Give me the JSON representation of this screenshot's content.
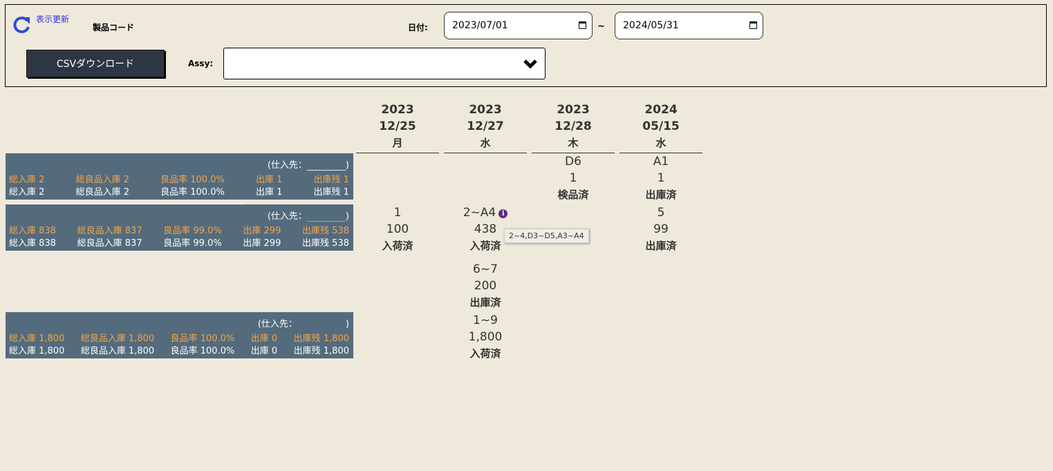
{
  "header": {
    "refresh_label": "表示更新",
    "product_code_label": "製品コード",
    "date_label": "日付:",
    "date_from": "2023/07/01",
    "date_to": "2024/05/31",
    "date_separator": "~",
    "csv_button_label": "CSVダウンロード",
    "assy_label": "Assy:",
    "assy_value": ""
  },
  "columns": [
    {
      "year": "2023",
      "date": "12/25",
      "dow": "月"
    },
    {
      "year": "2023",
      "date": "12/27",
      "dow": "水"
    },
    {
      "year": "2023",
      "date": "12/28",
      "dow": "木"
    },
    {
      "year": "2024",
      "date": "05/15",
      "dow": "水"
    }
  ],
  "panels": [
    {
      "supplier_prefix": "(仕入先：",
      "supplier_suffix": ")",
      "orange": [
        "総入庫 2",
        "総良品入庫 2",
        "良品率 100.0%",
        "出庫 1",
        "出庫残 1"
      ],
      "white": [
        "総入庫 2",
        "総良品入庫 2",
        "良品率 100.0%",
        "出庫 1",
        "出庫残 1"
      ]
    },
    {
      "supplier_prefix": "(仕入先：",
      "supplier_suffix": ")",
      "orange": [
        "総入庫 838",
        "総良品入庫 837",
        "良品率 99.0%",
        "出庫 299",
        "出庫残 538"
      ],
      "white": [
        "総入庫 838",
        "総良品入庫 837",
        "良品率 99.0%",
        "出庫 299",
        "出庫残 538"
      ]
    },
    {
      "supplier_prefix": "(仕入先：",
      "supplier_suffix": ")",
      "orange": [
        "総入庫 1,800",
        "総良品入庫 1,800",
        "良品率 100.0%",
        "出庫 0",
        "出庫残 1,800"
      ],
      "white": [
        "総入庫 1,800",
        "総良品入庫 1,800",
        "良品率 100.0%",
        "出庫 0",
        "出庫残 1,800"
      ]
    }
  ],
  "cells": {
    "r1_c3": {
      "lot": "D6",
      "qty": "1",
      "status": "検品済"
    },
    "r1_c4": {
      "lot": "A1",
      "qty": "1",
      "status": "出庫済"
    },
    "r2_c1": {
      "lot": "1",
      "qty": "100",
      "status": "入荷済"
    },
    "r2_c2": {
      "lot": "2~A4",
      "qty": "438",
      "status": "入荷済"
    },
    "r2_c4": {
      "lot": "5",
      "qty": "99",
      "status": "出庫済"
    },
    "r2b_c2": {
      "lot": "6~7",
      "qty": "200",
      "status": "出庫済"
    },
    "r3_c2": {
      "lot": "1~9",
      "qty": "1,800",
      "status": "入荷済"
    }
  },
  "tooltip": "2~4,D3~D5,A3~A4",
  "info_icon_glyph": "i"
}
